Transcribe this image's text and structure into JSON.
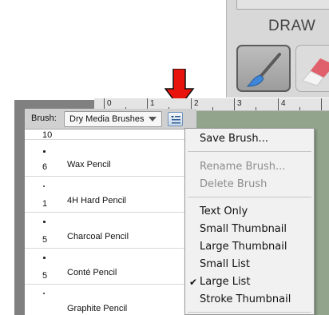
{
  "toolbar": {
    "section_label": "DRAW",
    "brush_tool_icon": "paintbrush-icon",
    "eraser_tool_icon": "eraser-icon"
  },
  "annotation": {
    "arrow_icon": "red-down-arrow-icon",
    "arrow_color": "#e8130c"
  },
  "ruler": {
    "ticks": [
      "0",
      "1",
      "2",
      "3",
      "4"
    ]
  },
  "brush_panel": {
    "label": "Brush:",
    "selected_library": "Dry Media Brushes",
    "menu_button_icon": "panel-menu-icon",
    "items": [
      {
        "size": "10",
        "name": ""
      },
      {
        "size": "6",
        "name": "Wax Pencil"
      },
      {
        "size": "1",
        "name": "4H Hard Pencil"
      },
      {
        "size": "5",
        "name": "Charcoal Pencil"
      },
      {
        "size": "5",
        "name": "Conté Pencil"
      },
      {
        "size": "",
        "name": "Graphite Pencil"
      }
    ]
  },
  "menu": {
    "items": [
      {
        "label": "Save Brush...",
        "enabled": true,
        "checked": false
      },
      {
        "label": "Rename Brush...",
        "enabled": false,
        "checked": false
      },
      {
        "label": "Delete Brush",
        "enabled": false,
        "checked": false
      },
      {
        "label": "Text Only",
        "enabled": true,
        "checked": false
      },
      {
        "label": "Small Thumbnail",
        "enabled": true,
        "checked": false
      },
      {
        "label": "Large Thumbnail",
        "enabled": true,
        "checked": false
      },
      {
        "label": "Small List",
        "enabled": true,
        "checked": false
      },
      {
        "label": "Large List",
        "enabled": true,
        "checked": true
      },
      {
        "label": "Stroke Thumbnail",
        "enabled": true,
        "checked": false
      }
    ],
    "checkmark": "✔"
  },
  "colors": {
    "canvas": "#93a48d",
    "menu_bg": "#f1f1f1",
    "panel_bg": "#808080"
  }
}
